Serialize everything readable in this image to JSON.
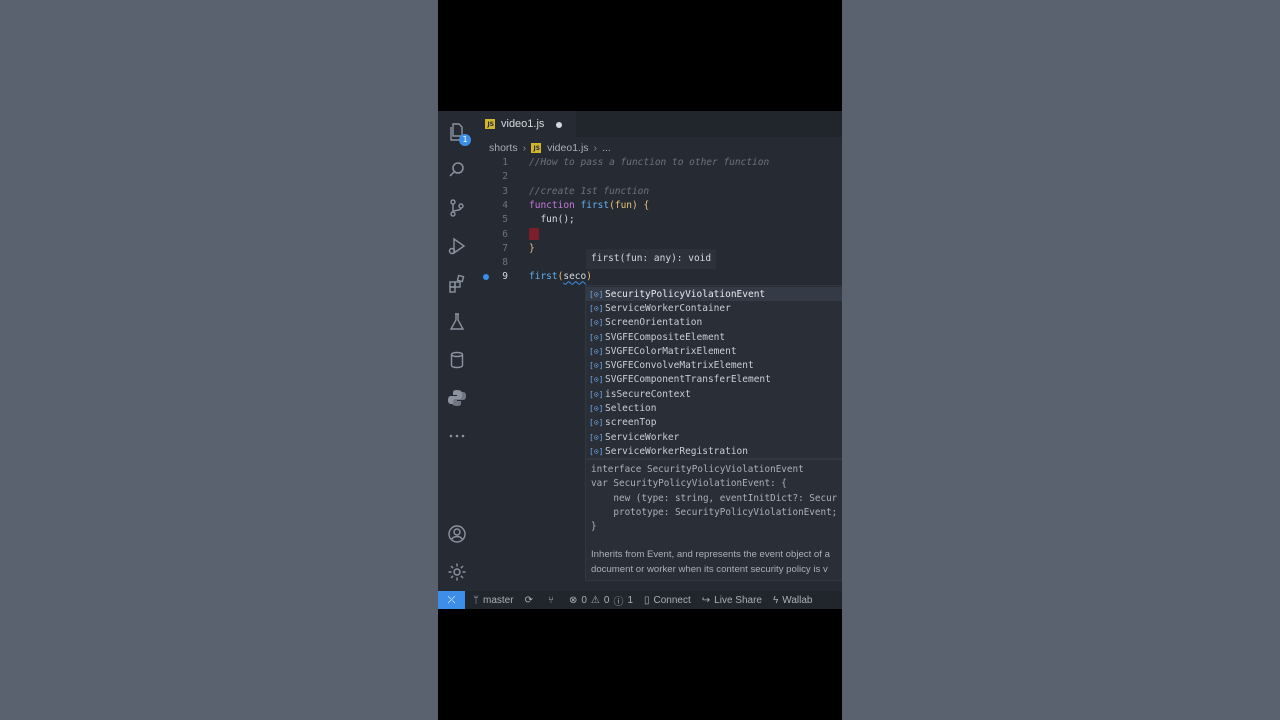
{
  "tab": {
    "filename": "video1.js",
    "js_badge": "JS"
  },
  "breadcrumb": {
    "folder": "shorts",
    "file": "video1.js",
    "ellipsis": "..."
  },
  "activity_badge": "1",
  "code": {
    "line_numbers": [
      "1",
      "2",
      "3",
      "4",
      "5",
      "6",
      "7",
      "8",
      "9"
    ],
    "l1": "//How to pass a function to other function",
    "l3": "//create 1st function",
    "l4_kw": "function",
    "l4_fn": "first",
    "l4_param": "fun",
    "l5": "  fun();",
    "l7": "}",
    "l9_fn": "first",
    "l9_arg": "seco"
  },
  "signature_hint": "first(fun: any): void",
  "suggestions": [
    "SecurityPolicyViolationEvent",
    "ServiceWorkerContainer",
    "ScreenOrientation",
    "SVGFECompositeElement",
    "SVGFEColorMatrixElement",
    "SVGFEConvolveMatrixElement",
    "SVGFEComponentTransferElement",
    "isSecureContext",
    "Selection",
    "screenTop",
    "ServiceWorker",
    "ServiceWorkerRegistration"
  ],
  "docs": {
    "code_lines": [
      "interface SecurityPolicyViolationEvent",
      "var SecurityPolicyViolationEvent: {",
      "    new (type: string, eventInitDict?: Secur",
      "    prototype: SecurityPolicyViolationEvent;",
      "}"
    ],
    "text_lines": [
      "Inherits from Event, and represents the event object of a",
      "document or worker when its content security policy is v"
    ]
  },
  "status": {
    "branch": "master",
    "errors": "0",
    "warnings": "0",
    "info": "1",
    "connect": "Connect",
    "live_share": "Live Share",
    "wallaby": "Wallab"
  }
}
